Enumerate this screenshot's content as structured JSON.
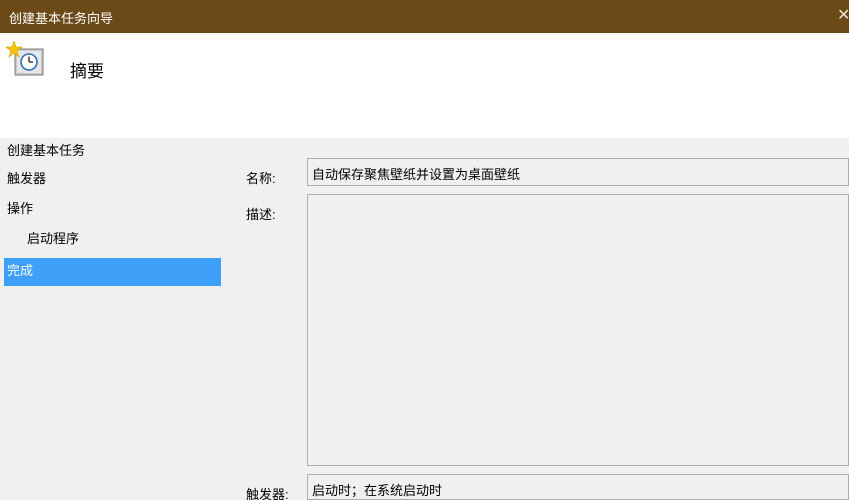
{
  "window": {
    "title": "创建基本任务向导",
    "close_glyph": "✕"
  },
  "header": {
    "heading": "摘要",
    "icon": "scheduled-task-clock-icon"
  },
  "sidebar": {
    "items": [
      {
        "label": "创建基本任务"
      },
      {
        "label": "触发器"
      },
      {
        "label": "操作"
      },
      {
        "label": "启动程序"
      },
      {
        "label": "完成",
        "selected": true
      }
    ]
  },
  "summary": {
    "name_label": "名称:",
    "name_value": "自动保存聚焦壁纸并设置为桌面壁纸",
    "description_label": "描述:",
    "description_value": "",
    "trigger_label": "触发器:",
    "trigger_value": "启动时；在系统启动时"
  },
  "colors": {
    "titlebar": "#6b4a18",
    "selection": "#3d9ff7",
    "panel": "#f0f0f0"
  }
}
